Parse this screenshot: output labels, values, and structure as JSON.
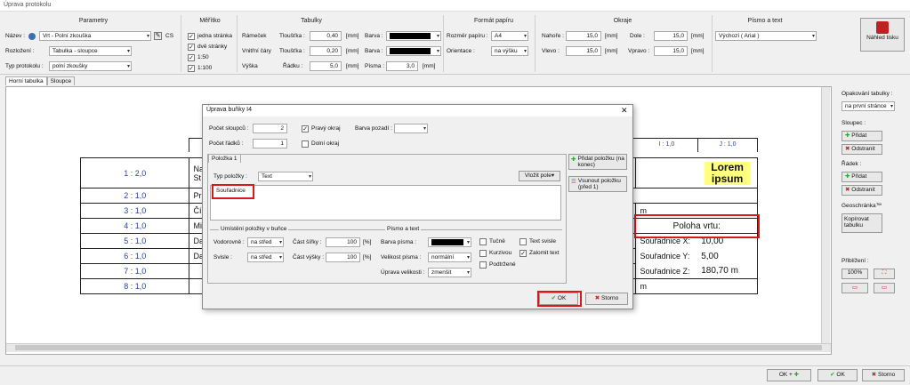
{
  "window_title": "Úprava protokolu",
  "ribbon": {
    "parametry": {
      "title": "Parametry",
      "name_label": "Název :",
      "name_value": "Vrt - Polní zkouška",
      "cs": "CS",
      "layout_label": "Rozložení :",
      "layout_value": "Tabulka - sloupce",
      "type_label": "Typ protokolu :",
      "type_value": "polní zkoušky"
    },
    "meritko": {
      "title": "Měřítko",
      "items": [
        "jedna stránka",
        "dvě stránky",
        "1:50",
        "1:100"
      ]
    },
    "tabulky": {
      "title": "Tabulky",
      "ramecek": "Rámeček",
      "vnitrni": "Vnitřní čáry",
      "vyska": "Výška",
      "tloustka": "Tloušťka :",
      "mm": "[mm]",
      "barva": "Barva :",
      "radku": "Řádku :",
      "pisma": "Písma :",
      "val1": "0,40",
      "val2": "0,20",
      "val3": "5,0",
      "val4": "3,0"
    },
    "format": {
      "title": "Formát papíru",
      "size_label": "Rozměr papíru :",
      "size_value": "A4",
      "orient_label": "Orientace :",
      "orient_value": "na výšku"
    },
    "okraje": {
      "title": "Okraje",
      "top": "Nahoře :",
      "bottom": "Dole :",
      "left": "Vlevo :",
      "right": "Vpravo :",
      "v_top": "15,0",
      "v_bottom": "15,0",
      "v_left": "15,0",
      "v_right": "15,0",
      "mm": "[mm]"
    },
    "pismo": {
      "title": "Písmo a text",
      "value": "Výchozí ( Arial )"
    },
    "preview_label": "Náhled tisku"
  },
  "tabs": [
    "Horní tabulka",
    "Sloupce"
  ],
  "grid": {
    "rows": [
      "1 : 2,0",
      "2 : 1,0",
      "3 : 1,0",
      "4 : 1,0",
      "5 : 1,0",
      "6 : 1,0",
      "7 : 1,0",
      "8 : 1,0"
    ],
    "row_texts": [
      "Na",
      "Pr",
      "Čí",
      "Mi",
      "Da",
      "Da",
      "",
      ""
    ],
    "row_texts2": [
      "St",
      "",
      "",
      "",
      "",
      "",
      "",
      ""
    ],
    "col_i": "I : 1,0",
    "col_j": "J : 1,0",
    "lorem1": "Lorem",
    "lorem2": "ipsum",
    "poloha": "Poloha vrtu:",
    "sx": "Souřadnice X:",
    "sx_v": "10,00",
    "sy": "Souřadnice Y:",
    "sy_v": "5,00",
    "sz": "Souřadnice Z:",
    "sz_v": "180,70 m",
    "m": "m"
  },
  "right": {
    "opak_label": "Opakování tabulky :",
    "opak_value": "na první stránce",
    "sloupec": "Sloupec :",
    "pridat": "Přidat",
    "odstranit": "Odstranit",
    "radek": "Řádek :",
    "geo": "Geoschránka™",
    "kopirovat": "Kopírovat tabulku",
    "zoom_label": "Přiblížení :",
    "zoom": "100%"
  },
  "dialog": {
    "title": "Úprava buňky I4",
    "cols_label": "Počet sloupců :",
    "cols": "2",
    "rows_label": "Počet řádků :",
    "rows": "1",
    "right_border": "Pravý okraj",
    "bottom_border": "Dolní okraj",
    "bg_label": "Barva pozadí :",
    "tab": "Položka 1",
    "item_type_label": "Typ položky :",
    "item_type": "Text",
    "insert_field": "Vložit pole",
    "text_value": "Souřadnice",
    "add_item": "Přidat položku (na konec)",
    "insert_item": "Vsunout položku (před 1)",
    "placement_title": "Umístění položky v buňce",
    "horiz": "Vodorovně :",
    "horiz_v": "na střed",
    "vert": "Svisle :",
    "vert_v": "na střed",
    "width_part": "Část šířky :",
    "width_v": "100",
    "height_part": "Část výšky :",
    "height_v": "100",
    "pct": "[%]",
    "font_title": "Písmo a text",
    "font_color": "Barva písma :",
    "font_size": "Velikost písma :",
    "font_size_v": "normální",
    "size_adj": "Úprava velikosti :",
    "size_adj_v": "zmenšit",
    "bold": "Tučně",
    "italic": "Kurzivou",
    "underline": "Podtržené",
    "vertical": "Text svisle",
    "wrap": "Zalomit text",
    "ok": "OK",
    "cancel": "Storno"
  },
  "footer": {
    "okplus": "OK +",
    "ok": "OK",
    "cancel": "Storno"
  }
}
